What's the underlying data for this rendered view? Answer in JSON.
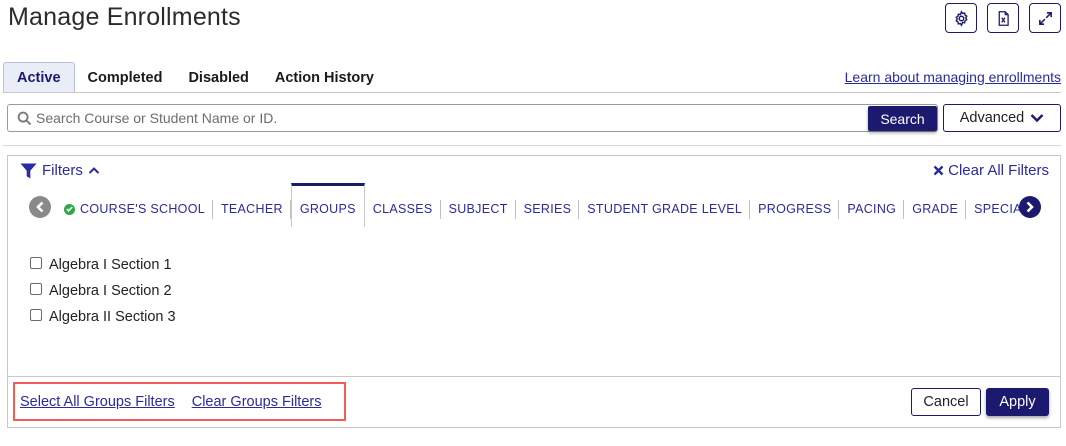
{
  "header": {
    "title": "Manage Enrollments",
    "icons": [
      "gear-icon",
      "excel-icon",
      "expand-icon"
    ]
  },
  "tabs": [
    {
      "label": "Active",
      "active": true
    },
    {
      "label": "Completed",
      "active": false
    },
    {
      "label": "Disabled",
      "active": false
    },
    {
      "label": "Action History",
      "active": false
    }
  ],
  "learn_link": "Learn about managing enrollments",
  "search": {
    "placeholder": "Search Course or Student Name or ID.",
    "value": "",
    "button_label": "Search",
    "advanced_label": "Advanced"
  },
  "filters": {
    "toggle_label": "Filters",
    "clear_all_label": "Clear All Filters",
    "tabs": [
      {
        "label": "COURSE'S SCHOOL",
        "checked": true,
        "active": false
      },
      {
        "label": "TEACHER",
        "checked": false,
        "active": false
      },
      {
        "label": "GROUPS",
        "checked": false,
        "active": true
      },
      {
        "label": "CLASSES",
        "checked": false,
        "active": false
      },
      {
        "label": "SUBJECT",
        "checked": false,
        "active": false
      },
      {
        "label": "SERIES",
        "checked": false,
        "active": false
      },
      {
        "label": "STUDENT GRADE LEVEL",
        "checked": false,
        "active": false
      },
      {
        "label": "PROGRESS",
        "checked": false,
        "active": false
      },
      {
        "label": "PACING",
        "checked": false,
        "active": false
      },
      {
        "label": "GRADE",
        "checked": false,
        "active": false
      },
      {
        "label": "SPECIA",
        "checked": false,
        "active": false
      }
    ],
    "options": [
      {
        "label": "Algebra I Section 1",
        "checked": false
      },
      {
        "label": "Algebra I Section 2",
        "checked": false
      },
      {
        "label": "Algebra II Section 3",
        "checked": false
      }
    ],
    "select_all_label": "Select All Groups Filters",
    "clear_group_label": "Clear Groups Filters",
    "cancel_label": "Cancel",
    "apply_label": "Apply"
  },
  "colors": {
    "brand": "#1c1a6e",
    "link": "#2b2a9e",
    "check": "#2ea84a",
    "highlight": "#f25c54"
  }
}
